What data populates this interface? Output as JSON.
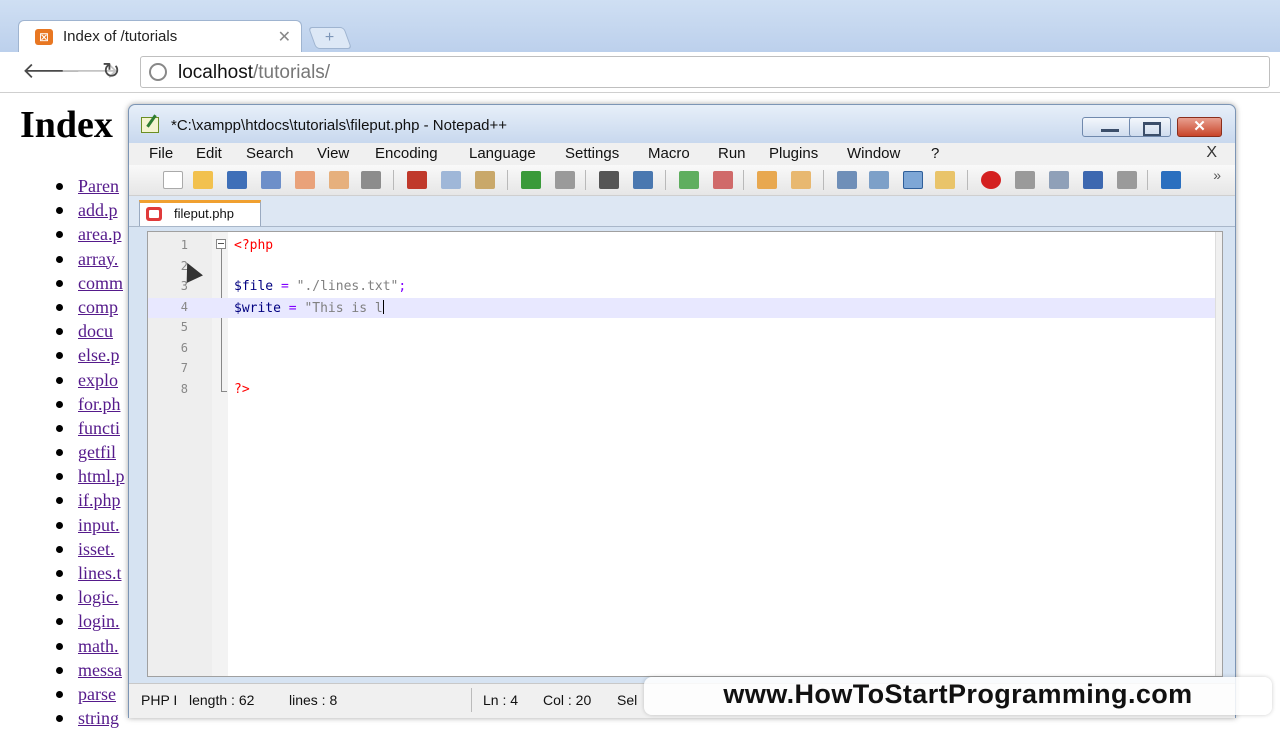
{
  "browser": {
    "tab_title": "Index of /tutorials",
    "url_host": "localhost",
    "url_path": "/tutorials/"
  },
  "page": {
    "heading": "Index",
    "files": [
      "Paren",
      "add.p",
      "area.p",
      "array.",
      "comm",
      "comp",
      "docu",
      "else.p",
      "explo",
      "for.ph",
      "functi",
      "getfil",
      "html.p",
      "if.php",
      "input.",
      "isset.",
      "lines.t",
      "logic.",
      "login.",
      "math.",
      "messa",
      "parse",
      "string"
    ]
  },
  "notepad": {
    "title": "*C:\\xampp\\htdocs\\tutorials\\fileput.php - Notepad++",
    "menu": [
      "File",
      "Edit",
      "Search",
      "View",
      "Encoding",
      "Language",
      "Settings",
      "Macro",
      "Run",
      "Plugins",
      "Window",
      "?"
    ],
    "menu_close": "X",
    "doc_tab": "fileput.php",
    "lines": [
      {
        "num": "1",
        "text": "<?php"
      },
      {
        "num": "2",
        "text": ""
      },
      {
        "num": "3",
        "text": "$file = \"./lines.txt\";"
      },
      {
        "num": "4",
        "text": "$write = \"This is l"
      },
      {
        "num": "5",
        "text": ""
      },
      {
        "num": "6",
        "text": ""
      },
      {
        "num": "7",
        "text": ""
      },
      {
        "num": "8",
        "text": "?>"
      }
    ],
    "status": {
      "lang": "PHP I",
      "length": "length : 62",
      "lines": "lines : 8",
      "ln": "Ln : 4",
      "col": "Col : 20",
      "sel": "Sel"
    }
  },
  "watermark": "www.HowToStartProgramming.com",
  "colors": {
    "php_tag": "#ff0000",
    "variable": "#000080",
    "operator": "#8000ff",
    "string": "#808080",
    "current_line": "#e8e8ff"
  }
}
